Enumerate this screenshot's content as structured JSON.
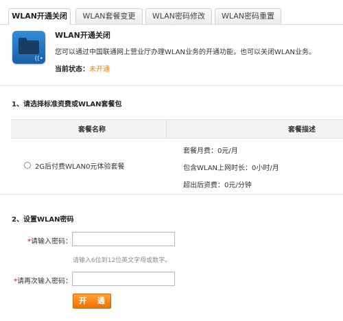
{
  "tabs": [
    {
      "label": "WLAN开通关闭",
      "active": true
    },
    {
      "label": "WLAN套餐变更",
      "active": false
    },
    {
      "label": "WLAN密码修改",
      "active": false
    },
    {
      "label": "WLAN密码重置",
      "active": false
    }
  ],
  "header": {
    "title": "WLAN开通关闭",
    "description": "您可以通过中国联通网上营业厅办理WLAN业务的开通功能，也可以关闭WLAN业务。",
    "status_label": "当前状态：",
    "status_value": "未开通",
    "status_color": "#f08300",
    "icon": "wlan-folder-icon"
  },
  "section1": {
    "title": "1、请选择标准资费或WLAN套餐包",
    "table": {
      "headers": [
        "套餐名称",
        "套餐描述"
      ],
      "rows": [
        {
          "name": "2G后付费WLAN0元体验套餐",
          "descriptions": [
            "套餐月费：0元/月",
            "包含WLAN上网时长：0小时/月",
            "超出后资费：0元/分钟"
          ]
        }
      ]
    }
  },
  "section2": {
    "title": "2、设置WLAN密码",
    "password_label": "请输入密码：",
    "password_value": "",
    "password_hint": "请输入6位到12位英文字母或数字。",
    "confirm_label": "请再次输入密码：",
    "confirm_value": "",
    "submit_label": "开 通",
    "accent_color": "#f07000"
  }
}
